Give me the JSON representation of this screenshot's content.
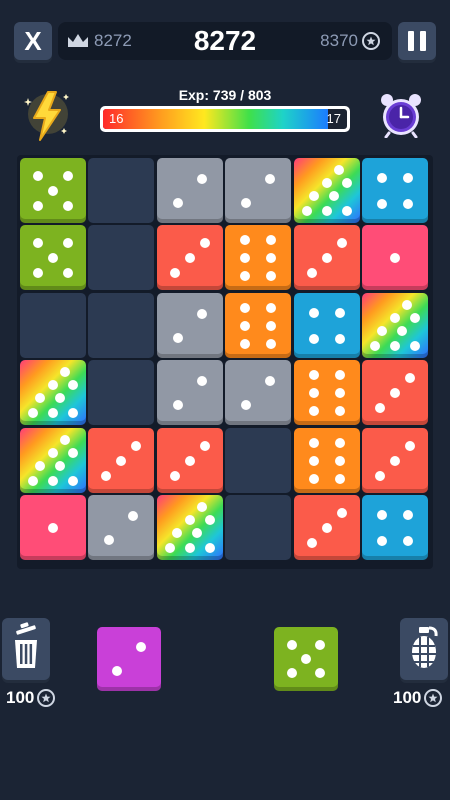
{
  "top": {
    "close_label": "X",
    "best_score": "8272",
    "score": "8272",
    "coins": "8370",
    "coin_symbol": "⭘"
  },
  "progress": {
    "exp_label": "Exp: 739 / 803",
    "exp_current": 739,
    "exp_max": 803,
    "level_current": "16",
    "level_next": "17"
  },
  "board": {
    "rows": 6,
    "cols": 6,
    "cells": [
      [
        5,
        0,
        2,
        2,
        7,
        4
      ],
      [
        5,
        0,
        3,
        6,
        3,
        1
      ],
      [
        0,
        0,
        2,
        6,
        4,
        7
      ],
      [
        7,
        0,
        2,
        2,
        6,
        3
      ],
      [
        7,
        3,
        3,
        0,
        6,
        3
      ],
      [
        1,
        2,
        7,
        0,
        3,
        4
      ]
    ],
    "legend": {
      "0": "empty",
      "1": "one",
      "2": "two",
      "3": "three",
      "4": "four",
      "5": "five",
      "6": "six",
      "7": "seven-rainbow"
    }
  },
  "die_colors": {
    "1": "#ff4d77",
    "2": "#9198a5",
    "3": "#fb5b4a",
    "4": "#1ea3d9",
    "5": "#7db320",
    "6": "#ff8a1c",
    "2p": "#c940d8"
  },
  "queue": {
    "piece_a": {
      "pips": 2,
      "color": "#c940d8"
    },
    "piece_b": {
      "pips": 5,
      "color": "#7db320"
    }
  },
  "tools": {
    "trash_cost": "100",
    "bomb_cost": "100"
  }
}
